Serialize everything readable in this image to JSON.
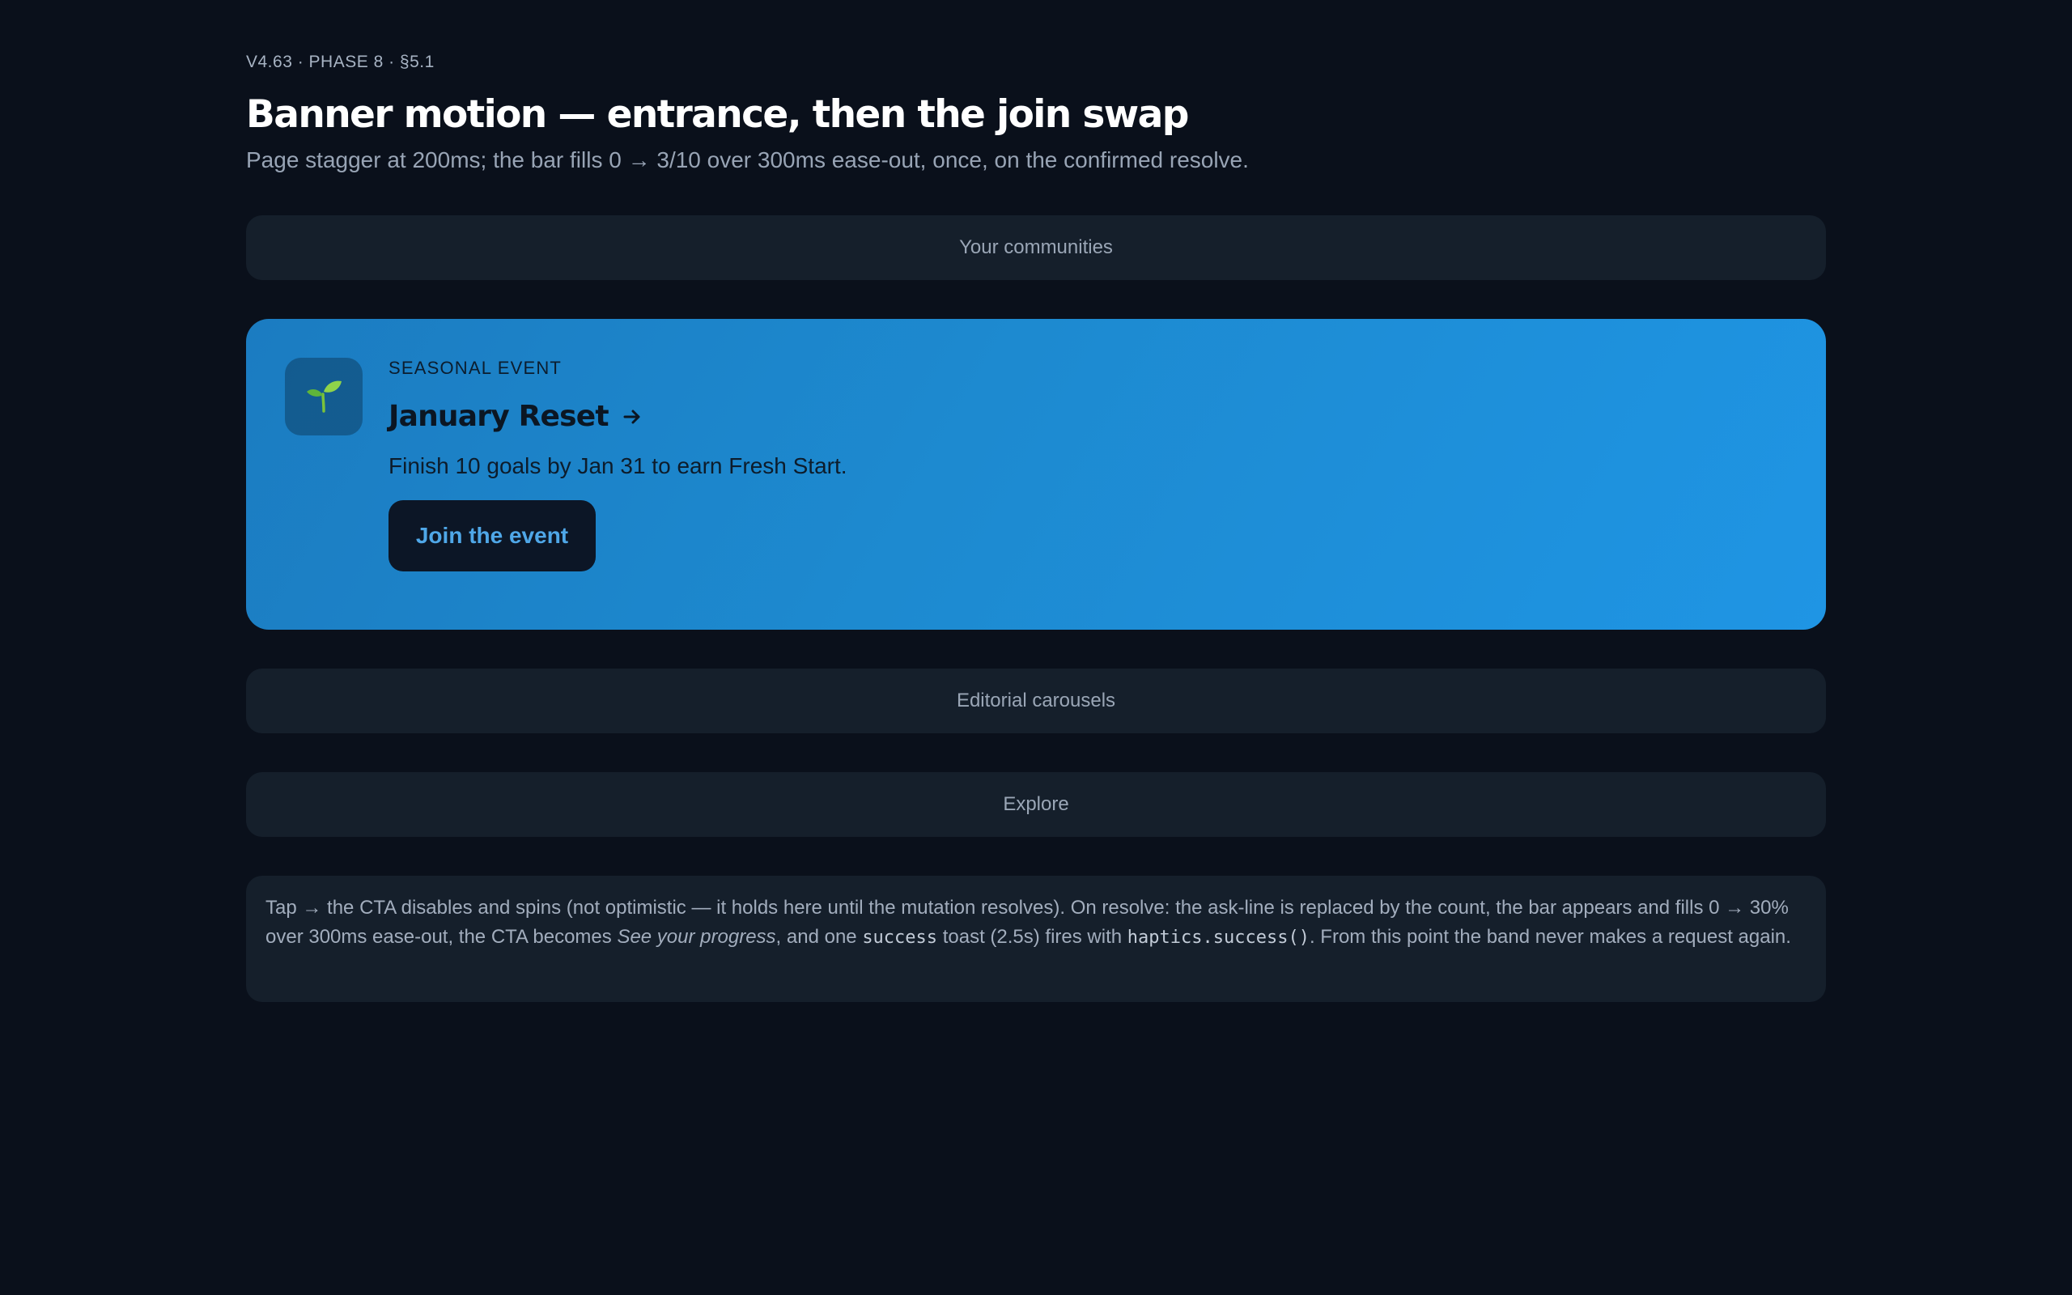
{
  "header": {
    "eyebrow": "V4.63 · PHASE 8 · §5.1",
    "title": "Banner motion — entrance, then the join swap",
    "subtitle": "Page stagger at 200ms; the bar fills 0 → 3/10 over 300ms ease-out, once, on the confirmed resolve."
  },
  "sections": {
    "communities": "Your communities",
    "editorial": "Editorial carousels",
    "explore": "Explore"
  },
  "banner": {
    "kicker": "SEASONAL EVENT",
    "title": "January Reset",
    "description": "Finish 10 goals by Jan 31 to earn Fresh Start.",
    "cta_label": "Join the event",
    "icon": "seedling-icon"
  },
  "note": {
    "part1": "Tap → the CTA disables and spins (not optimistic — it holds here until the mutation resolves). On resolve: the ask-line is replaced by the count, the bar appears and fills 0 → 30% over 300ms ease-out, the CTA becomes ",
    "italic": "See your progress",
    "part2": ", and one ",
    "code1": "success",
    "part3": " toast (2.5s) fires with ",
    "code2": "haptics.success()",
    "part4": ". From this point the band never makes a request again."
  },
  "colors": {
    "background": "#0a101b",
    "card": "#151f2b",
    "banner_start": "#1b7cc1",
    "banner_end": "#1f95e4",
    "cta_bg": "#0c1626",
    "cta_text": "#4fa7e8"
  }
}
